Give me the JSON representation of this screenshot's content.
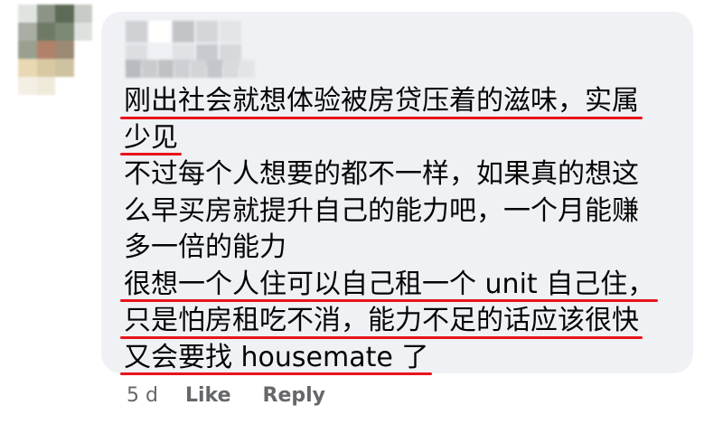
{
  "avatar": {
    "pixels": [
      "#dfe4e0",
      "#8c9486",
      "#5c6b55",
      "#c9ccc6",
      "#a8aea3",
      "#6f7a66",
      "#7c8974",
      "#dfe2dc",
      "#9aa08f",
      "#b2816a",
      "#9c8974",
      "#ffffff",
      "#e8d8b4",
      "#d9c9a3",
      "#cfc2a0",
      "#ffffff",
      "#f3efe4",
      "#f0eadb",
      "#ffffff",
      "#ffffff"
    ]
  },
  "author_redacted": {
    "row1": [
      "#cfd1d5",
      "#ffffff",
      "#c2c4c8",
      "#d4d6da",
      "#e3e5e8",
      "#eff1f4",
      "#dcdee2",
      "#eff1f4",
      "#dfe1e5",
      "#c8cace",
      "#d6d8dc",
      "#eff1f4"
    ],
    "row2": [
      "#b9bbbf",
      "#c9cbcf",
      "#bfc1c5",
      "#cdd0d3",
      "#d2d4d8",
      "#c4c6ca",
      "#d8dadd",
      "#e2e4e7"
    ]
  },
  "comment": {
    "lines": [
      {
        "text": "刚出社会就想体验被房贷压着的滋味，实属",
        "highlight": true
      },
      {
        "text": "少见",
        "highlight": true
      },
      {
        "text": "不过每个人想要的都不一样，如果真的想这",
        "highlight": false
      },
      {
        "text": "么早买房就提升自己的能力吧，一个月能赚",
        "highlight": false
      },
      {
        "text": "多一倍的能力",
        "highlight": false
      },
      {
        "text": "很想一个人住可以自己租一个 unit 自己住，",
        "highlight": true
      },
      {
        "text": "只是怕房租吃不消，能力不足的话应该很快",
        "highlight": true
      },
      {
        "text": "又会要找 housemate 了",
        "highlight": true
      }
    ]
  },
  "footer": {
    "timestamp": "5 d",
    "like_label": "Like",
    "reply_label": "Reply"
  },
  "colors": {
    "bubble": "#eff1f4",
    "text": "#050505",
    "underline": "#e8141b",
    "meta": "#65676b"
  }
}
